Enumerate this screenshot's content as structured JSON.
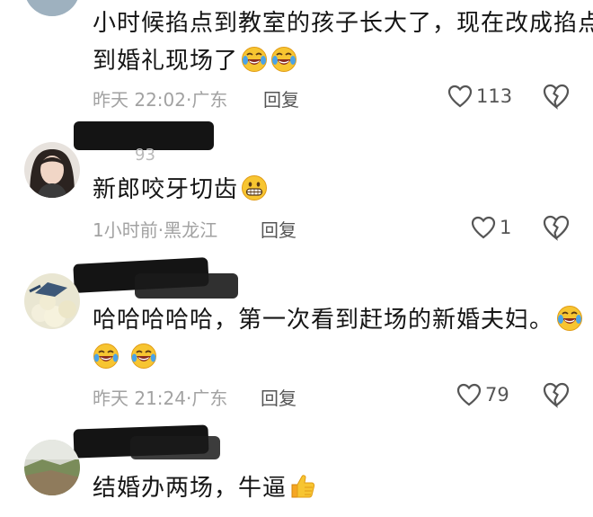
{
  "comments": [
    {
      "text_lines": [
        "小时候掐点到教室的孩子长大了，现在改成掐点",
        "到婚礼现场了"
      ],
      "emojis": [
        "tears-of-joy",
        "tears-of-joy"
      ],
      "time": "昨天 22:02",
      "location": "广东",
      "reply_label": "回复",
      "like_count": "113"
    },
    {
      "name_fragment": "93",
      "text": "新郎咬牙切齿",
      "emojis": [
        "grinning"
      ],
      "time": "1小时前",
      "location": "黑龙江",
      "reply_label": "回复",
      "like_count": "1"
    },
    {
      "text": "哈哈哈哈哈，第一次看到赶场的新婚夫妇。",
      "emojis": [
        "tears-of-joy"
      ],
      "second_line_emojis": [
        "grinning-sweat",
        "grinning-sweat"
      ],
      "time": "昨天 21:24",
      "location": "广东",
      "reply_label": "回复",
      "like_count": "79"
    },
    {
      "text": "结婚办两场，牛逼",
      "emojis": [
        "thumbs-up"
      ]
    }
  ],
  "separator": "·",
  "colors": {
    "text": "#151515",
    "meta": "#a2a2a2",
    "action": "#555555",
    "redaction": "#141414"
  }
}
